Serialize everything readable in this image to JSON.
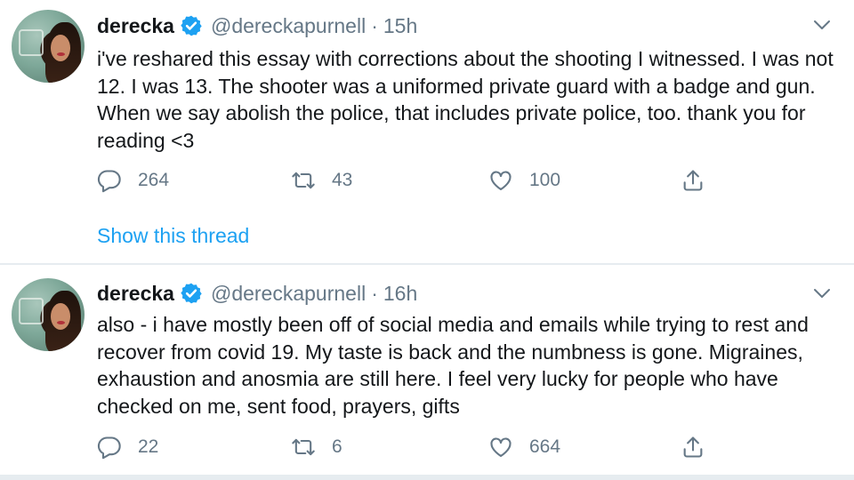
{
  "colors": {
    "accent": "#1da1f2",
    "secondary_text": "#657786",
    "primary_text": "#14171a",
    "divider": "#e6ecf0"
  },
  "tweets": [
    {
      "name": "derecka",
      "handle": "@dereckapurnell",
      "separator": "·",
      "time": "15h",
      "text": "i've reshared this essay with corrections about the shooting I witnessed. I was not 12. I was 13. The shooter was a uniformed private guard with a badge and gun. When we say abolish the police, that includes private police, too. thank you for reading <3",
      "replies": "264",
      "retweets": "43",
      "likes": "100",
      "show_thread": "Show this thread"
    },
    {
      "name": "derecka",
      "handle": "@dereckapurnell",
      "separator": "·",
      "time": "16h",
      "text": "also - i have mostly been off of social media and emails while trying to rest and recover from covid 19. My taste is back and the numbness is gone. Migraines, exhaustion and anosmia are still here. I feel very lucky for people who have checked on me, sent food, prayers, gifts",
      "replies": "22",
      "retweets": "6",
      "likes": "664"
    }
  ],
  "icons": {
    "verified": "verified-badge-icon",
    "caret": "chevron-down-icon",
    "reply": "reply-bubble-icon",
    "retweet": "retweet-icon",
    "like": "heart-icon",
    "share": "share-upload-icon"
  }
}
